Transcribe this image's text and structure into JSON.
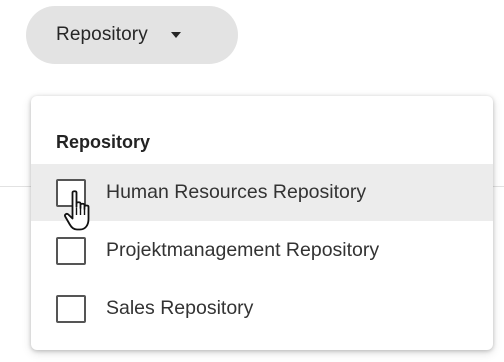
{
  "filter_chip": {
    "label": "Repository",
    "icon": "caret-down-icon"
  },
  "dropdown": {
    "title": "Repository",
    "options": [
      {
        "label": "Human Resources Repository",
        "checked": false,
        "hovered": true
      },
      {
        "label": "Projektmanagement Repository",
        "checked": false,
        "hovered": false
      },
      {
        "label": "Sales Repository",
        "checked": false,
        "hovered": false
      }
    ]
  },
  "pointer": {
    "icon": "hand-pointer-icon"
  },
  "colors": {
    "chip_background": "#e3e3e3",
    "hover_background": "#ececec",
    "checkbox_border": "#555555"
  }
}
